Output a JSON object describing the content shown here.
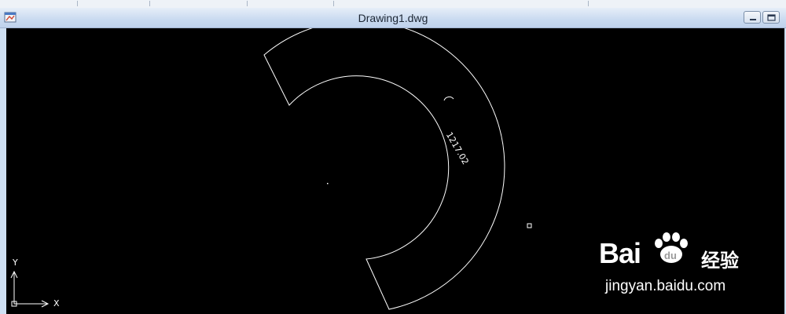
{
  "window": {
    "title": "Drawing1.dwg"
  },
  "drawing": {
    "dimension_text": "1217.02",
    "axis_y_label": "Y",
    "axis_x_label": "X",
    "line_color": "#ffffff",
    "background_color": "#000000"
  },
  "watermark": {
    "brand": "Bai",
    "brand_suffix": "du",
    "cn_text": "经验",
    "url": "jingyan.baidu.com"
  },
  "icons": {
    "app": "app-icon",
    "minimize": "minimize-icon",
    "restore": "restore-icon",
    "ucs": "ucs-icon",
    "paw": "paw-icon"
  }
}
